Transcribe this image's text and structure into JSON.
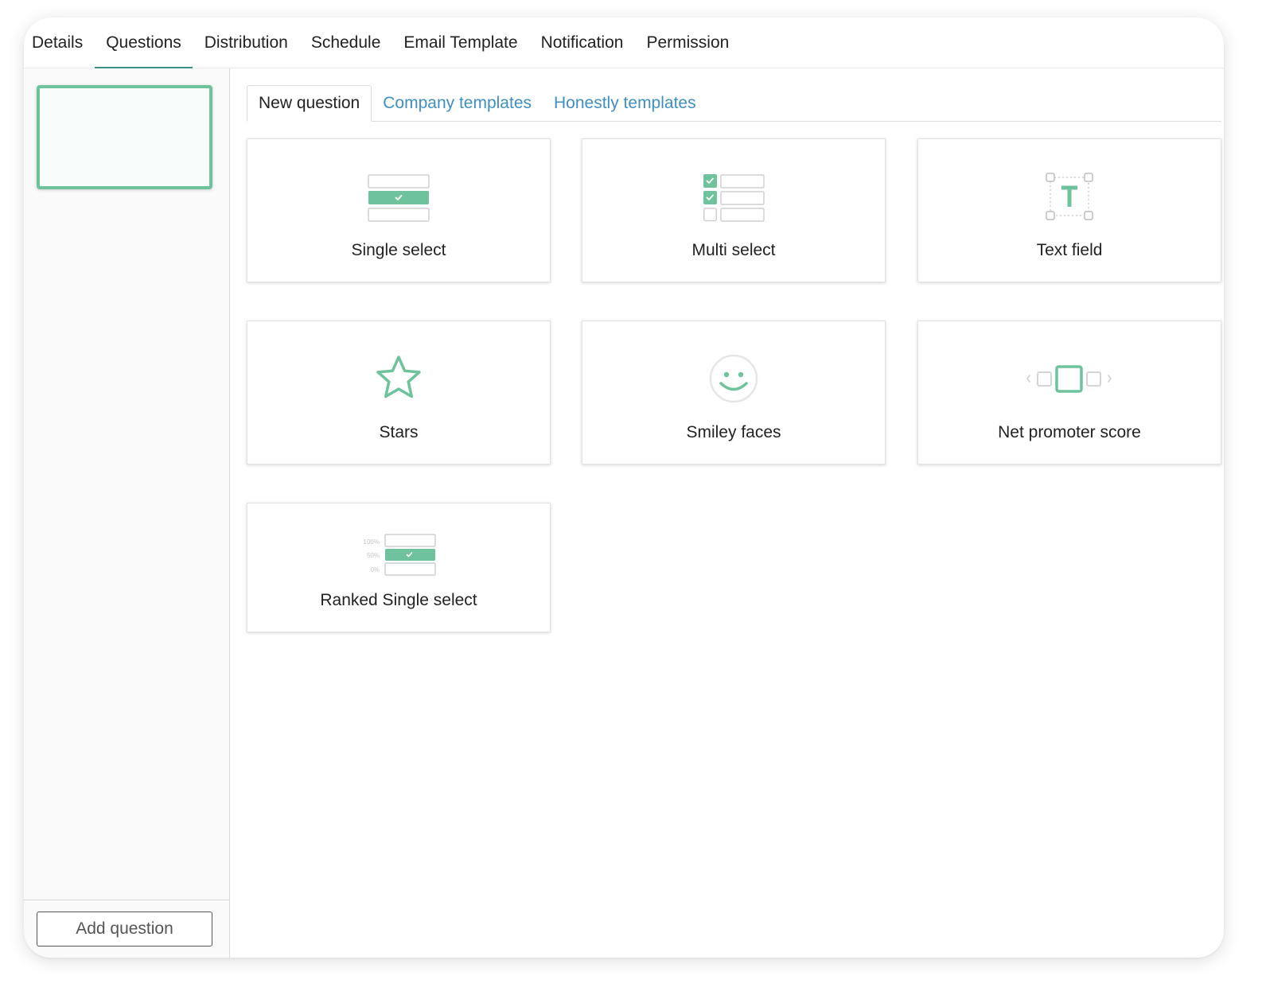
{
  "top_tabs": [
    {
      "label": "Details",
      "active": false
    },
    {
      "label": "Questions",
      "active": true
    },
    {
      "label": "Distribution",
      "active": false
    },
    {
      "label": "Schedule",
      "active": false
    },
    {
      "label": "Email Template",
      "active": false
    },
    {
      "label": "Notification",
      "active": false
    },
    {
      "label": "Permission",
      "active": false
    }
  ],
  "sidebar": {
    "add_question_label": "Add question"
  },
  "sub_tabs": [
    {
      "label": "New question",
      "active": true
    },
    {
      "label": "Company templates",
      "active": false
    },
    {
      "label": "Honestly templates",
      "active": false
    }
  ],
  "question_types": [
    {
      "label": "Single select",
      "icon": "single-select-icon"
    },
    {
      "label": "Multi select",
      "icon": "multi-select-icon"
    },
    {
      "label": "Text field",
      "icon": "text-field-icon"
    },
    {
      "label": "Stars",
      "icon": "star-icon"
    },
    {
      "label": "Smiley faces",
      "icon": "smiley-face-icon"
    },
    {
      "label": "Net promoter score",
      "icon": "net-promoter-score-icon"
    },
    {
      "label": "Ranked Single select",
      "icon": "ranked-single-select-icon",
      "scale_labels": [
        "100%",
        "50%",
        "0%"
      ]
    }
  ],
  "colors": {
    "accent_green": "#6fc39c",
    "tab_underline": "#3d8f85",
    "link_blue": "#3f8fc2"
  }
}
